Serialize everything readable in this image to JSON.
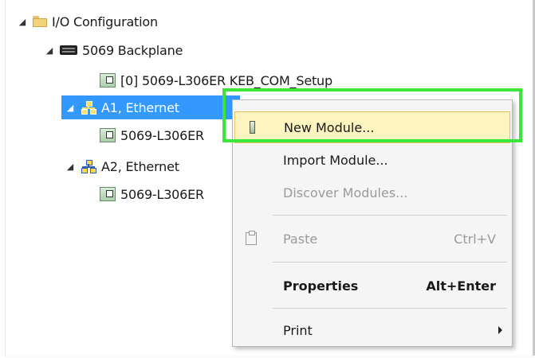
{
  "tree": {
    "io_configuration": {
      "label": "I/O Configuration",
      "arrow": "◢"
    },
    "backplane": {
      "label": "5069 Backplane",
      "arrow": "◢"
    },
    "controller_module": {
      "label": "[0] 5069-L306ER KEB_COM_Setup"
    },
    "a1_ethernet": {
      "label": "A1, Ethernet",
      "arrow": "◢"
    },
    "a1_child": {
      "label": "5069-L306ER"
    },
    "a2_ethernet": {
      "label": "A2, Ethernet",
      "arrow": "◢"
    },
    "a2_child": {
      "label": "5069-L306ER"
    }
  },
  "context_menu": {
    "new_module": {
      "label": "New Module..."
    },
    "import_module": {
      "label": "Import Module..."
    },
    "discover_modules": {
      "label": "Discover Modules..."
    },
    "paste": {
      "label": "Paste",
      "shortcut": "Ctrl+V"
    },
    "properties": {
      "label": "Properties",
      "shortcut": "Alt+Enter"
    },
    "print": {
      "label": "Print"
    }
  },
  "colors": {
    "selection": "#3399ff",
    "menu_hover": "#fdf4bf",
    "highlight": "#39e639"
  }
}
